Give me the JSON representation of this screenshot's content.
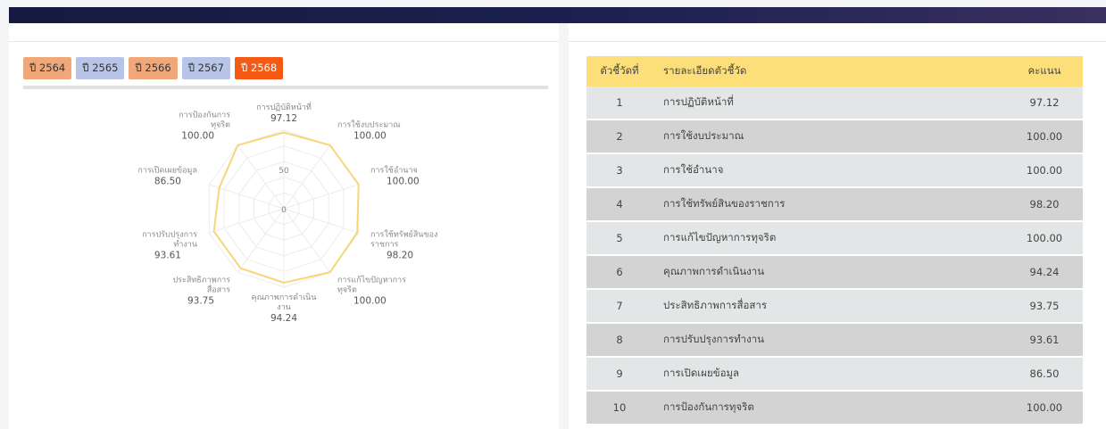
{
  "year_tabs": [
    {
      "label": "ปี 2564",
      "style": "orange"
    },
    {
      "label": "ปี 2565",
      "style": "blue"
    },
    {
      "label": "ปี 2566",
      "style": "orange"
    },
    {
      "label": "ปี 2567",
      "style": "blue"
    },
    {
      "label": "ปี 2568",
      "style": "active"
    }
  ],
  "colors": {
    "radar_line": "#f5d77a",
    "active_tab": "#f45a14",
    "table_header": "#fddf7a"
  },
  "chart_data": {
    "type": "radar",
    "max": 100,
    "tick_labels": [
      "0",
      "50"
    ],
    "axes": [
      {
        "label_lines": [
          "การปฏิบัติหน้าที่"
        ],
        "value": 97.12,
        "value_text": "97.12"
      },
      {
        "label_lines": [
          "การใช้งบประมาณ"
        ],
        "value": 100.0,
        "value_text": "100.00"
      },
      {
        "label_lines": [
          "การใช้อำนาจ"
        ],
        "value": 100.0,
        "value_text": "100.00"
      },
      {
        "label_lines": [
          "การใช้ทรัพย์สินของ",
          "ราชการ"
        ],
        "value": 98.2,
        "value_text": "98.20"
      },
      {
        "label_lines": [
          "การแก้ไขปัญหาการ",
          "ทุจริต"
        ],
        "value": 100.0,
        "value_text": "100.00"
      },
      {
        "label_lines": [
          "คุณภาพการดำเนิน",
          "งาน"
        ],
        "value": 94.24,
        "value_text": "94.24"
      },
      {
        "label_lines": [
          "ประสิทธิภาพการ",
          "สื่อสาร"
        ],
        "value": 93.75,
        "value_text": "93.75"
      },
      {
        "label_lines": [
          "การปรับปรุงการ",
          "ทำงาน"
        ],
        "value": 93.61,
        "value_text": "93.61"
      },
      {
        "label_lines": [
          "การเปิดเผยข้อมูล"
        ],
        "value": 86.5,
        "value_text": "86.50"
      },
      {
        "label_lines": [
          "การป้องกันการ",
          "ทุจริต"
        ],
        "value": 100.0,
        "value_text": "100.00"
      }
    ]
  },
  "table": {
    "headers": {
      "no": "ตัวชี้วัดที่",
      "desc": "รายละเอียดตัวชี้วัด",
      "score": "คะแนน"
    },
    "rows": [
      {
        "no": "1",
        "desc": "การปฏิบัติหน้าที่",
        "score": "97.12"
      },
      {
        "no": "2",
        "desc": "การใช้งบประมาณ",
        "score": "100.00"
      },
      {
        "no": "3",
        "desc": "การใช้อำนาจ",
        "score": "100.00"
      },
      {
        "no": "4",
        "desc": "การใช้ทรัพย์สินของราชการ",
        "score": "98.20"
      },
      {
        "no": "5",
        "desc": "การแก้ไขปัญหาการทุจริต",
        "score": "100.00"
      },
      {
        "no": "6",
        "desc": "คุณภาพการดำเนินงาน",
        "score": "94.24"
      },
      {
        "no": "7",
        "desc": "ประสิทธิภาพการสื่อสาร",
        "score": "93.75"
      },
      {
        "no": "8",
        "desc": "การปรับปรุงการทำงาน",
        "score": "93.61"
      },
      {
        "no": "9",
        "desc": "การเปิดเผยข้อมูล",
        "score": "86.50"
      },
      {
        "no": "10",
        "desc": "การป้องกันการทุจริต",
        "score": "100.00"
      }
    ]
  }
}
